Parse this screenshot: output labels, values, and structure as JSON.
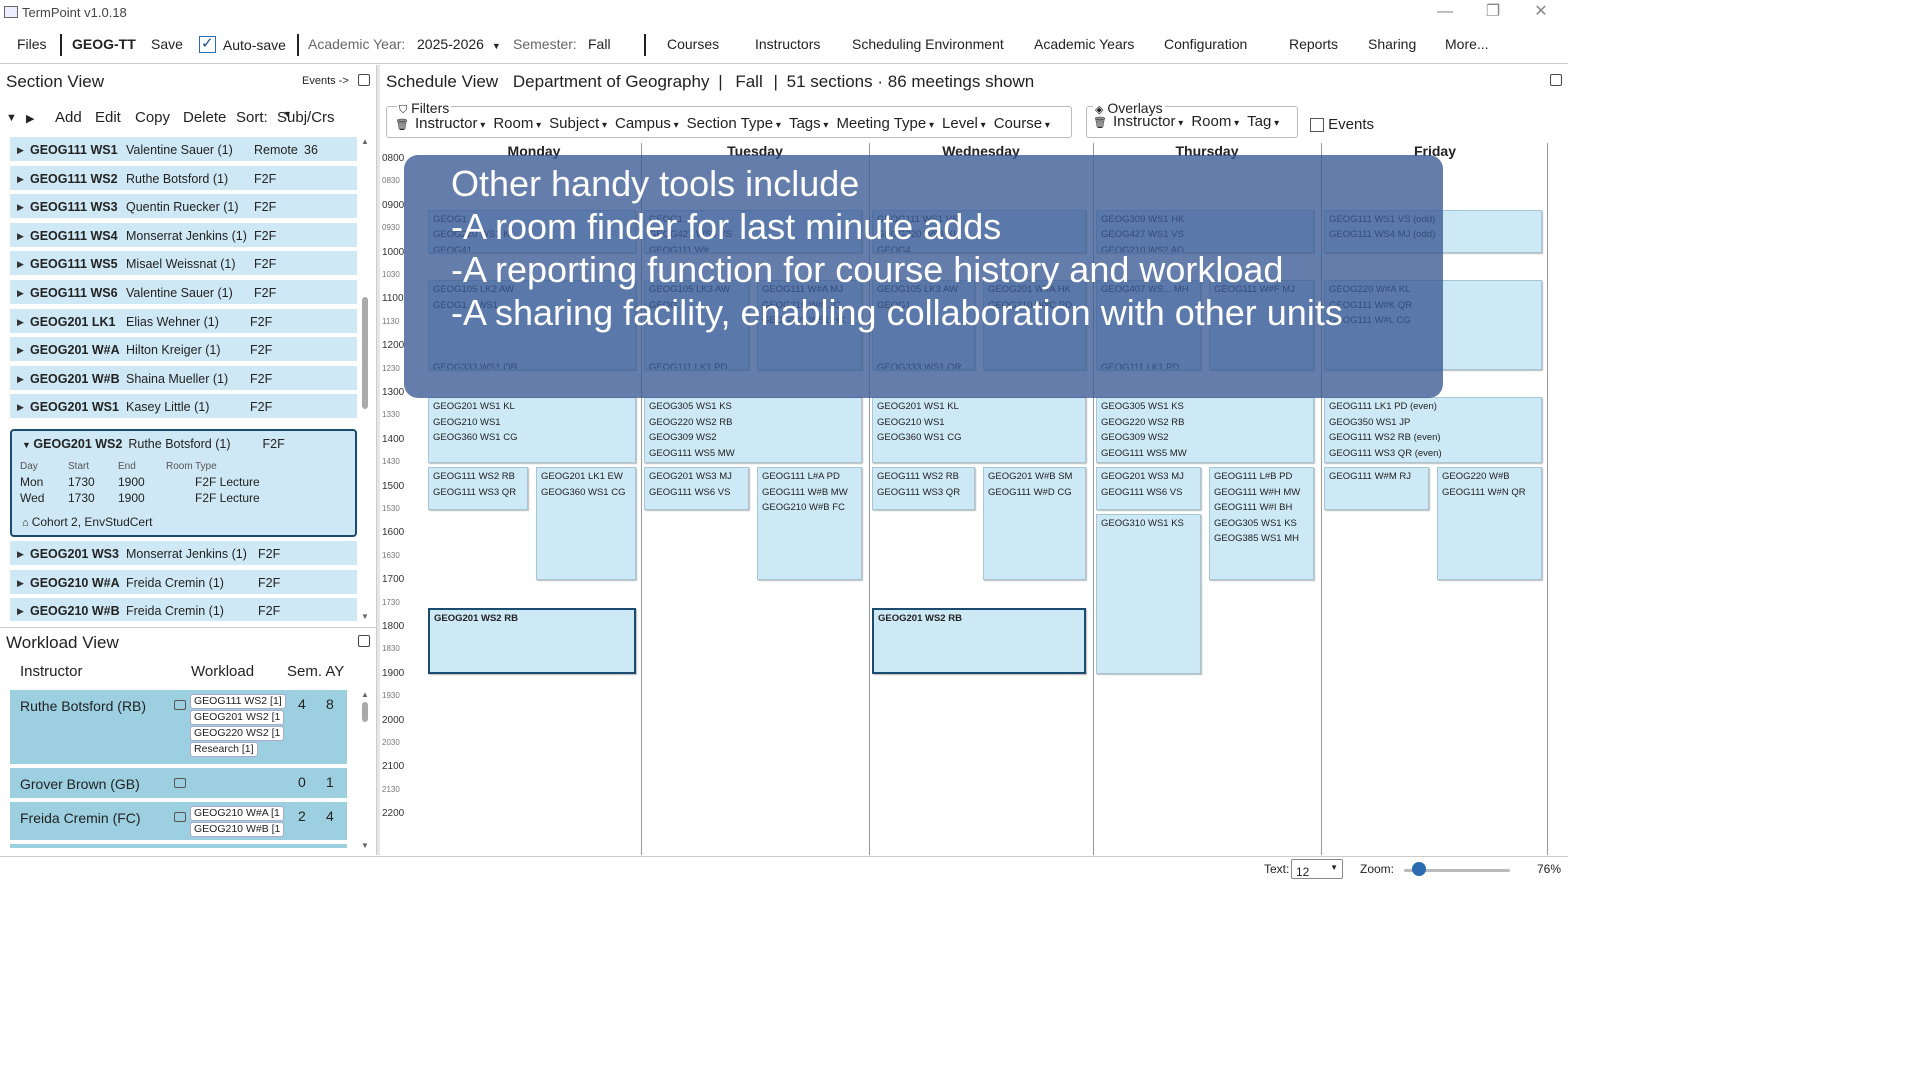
{
  "window": {
    "title": "TermPoint v1.0.18",
    "minimize": "—",
    "restore": "❐",
    "close": "✕"
  },
  "menubar": {
    "files": "Files",
    "file_name": "GEOG-TT",
    "save": "Save",
    "autosave": "Auto-save",
    "academic_year_label": "Academic Year:",
    "academic_year_value": "2025-2026",
    "semester_label": "Semester:",
    "semester_value": "Fall",
    "menus": [
      "Courses",
      "Instructors",
      "Scheduling Environment",
      "Academic Years",
      "Configuration",
      "Reports",
      "Sharing",
      "More..."
    ]
  },
  "section_view": {
    "title": "Section View",
    "events_link": "Events ->",
    "toolbar": {
      "expand": "▼",
      "collapse": "▶",
      "add": "Add",
      "edit": "Edit",
      "copy": "Copy",
      "delete": "Delete",
      "sort_label": "Sort:",
      "sort_value": "Subj/Crs"
    },
    "rows": [
      {
        "code": "GEOG111 WS1",
        "instr": "Valentine Sauer (1)",
        "type": "Remote",
        "extra": "36"
      },
      {
        "code": "GEOG111 WS2",
        "instr": "Ruthe Botsford (1)",
        "type": "F2F",
        "extra": ""
      },
      {
        "code": "GEOG111 WS3",
        "instr": "Quentin Ruecker (1)",
        "type": "F2F",
        "extra": ""
      },
      {
        "code": "GEOG111 WS4",
        "instr": "Monserrat Jenkins (1)",
        "type": "F2F",
        "extra": ""
      },
      {
        "code": "GEOG111 WS5",
        "instr": "Misael Weissnat (1)",
        "type": "F2F",
        "extra": ""
      },
      {
        "code": "GEOG111 WS6",
        "instr": "Valentine Sauer (1)",
        "type": "F2F",
        "extra": ""
      },
      {
        "code": "GEOG201 LK1",
        "instr": "Elias Wehner (1)",
        "type": "F2F",
        "extra": ""
      },
      {
        "code": "GEOG201 W#A",
        "instr": "Hilton Kreiger (1)",
        "type": "F2F",
        "extra": ""
      },
      {
        "code": "GEOG201 W#B",
        "instr": "Shaina Mueller (1)",
        "type": "F2F",
        "extra": ""
      },
      {
        "code": "GEOG201 WS1",
        "instr": "Kasey Little (1)",
        "type": "F2F",
        "extra": ""
      }
    ],
    "expanded": {
      "code": "GEOG201 WS2",
      "instr": "Ruthe Botsford (1)",
      "type": "F2F",
      "headers": {
        "day": "Day",
        "start": "Start",
        "end": "End",
        "room": "Room",
        "type": "Type"
      },
      "meetings": [
        {
          "day": "Mon",
          "start": "1730",
          "end": "1900",
          "room": "",
          "type": "F2F Lecture"
        },
        {
          "day": "Wed",
          "start": "1730",
          "end": "1900",
          "room": "",
          "type": "F2F Lecture"
        }
      ],
      "tags": "Cohort 2, EnvStudCert"
    },
    "rows_after": [
      {
        "code": "GEOG201 WS3",
        "instr": "Monserrat Jenkins (1)",
        "type": "F2F"
      },
      {
        "code": "GEOG210 W#A",
        "instr": "Freida Cremin (1)",
        "type": "F2F"
      },
      {
        "code": "GEOG210 W#B",
        "instr": "Freida Cremin (1)",
        "type": "F2F"
      }
    ]
  },
  "workload_view": {
    "title": "Workload View",
    "headers": {
      "instructor": "Instructor",
      "workload": "Workload",
      "sem_ay": "Sem. AY"
    },
    "rows": [
      {
        "name": "Ruthe Botsford (RB)",
        "chips": [
          "GEOG111 WS2 [1]",
          "GEOG201 WS2 [1",
          "GEOG220 WS2 [1",
          "Research [1]"
        ],
        "sem": "4",
        "ay": "8"
      },
      {
        "name": "Grover Brown (GB)",
        "chips": [],
        "sem": "0",
        "ay": "1"
      },
      {
        "name": "Freida Cremin (FC)",
        "chips": [
          "GEOG210 W#A [1",
          "GEOG210 W#B [1"
        ],
        "sem": "2",
        "ay": "4"
      }
    ]
  },
  "schedule_view": {
    "title": "Schedule View",
    "department": "Department of Geography",
    "semester": "Fall",
    "summary": "51 sections · 86 meetings shown",
    "filters_label": "Filters",
    "filters": [
      "Instructor",
      "Room",
      "Subject",
      "Campus",
      "Section Type",
      "Tags",
      "Meeting Type",
      "Level",
      "Course"
    ],
    "overlays_label": "Overlays",
    "overlays": [
      "Instructor",
      "Room",
      "Tag"
    ],
    "events_label": "Events",
    "days": [
      "Monday",
      "Tuesday",
      "Wednesday",
      "Thursday",
      "Friday"
    ],
    "times": [
      "0800",
      "0830",
      "0900",
      "0930",
      "1000",
      "1030",
      "1100",
      "1130",
      "1200",
      "1230",
      "1300",
      "1330",
      "1400",
      "1430",
      "1500",
      "1530",
      "1600",
      "1630",
      "1700",
      "1730",
      "1800",
      "1830",
      "1900",
      "1930",
      "2000",
      "2030",
      "2100",
      "2130",
      "2200"
    ],
    "blocks": [
      {
        "day": 0,
        "col": 0,
        "cols": 1,
        "start": 900,
        "end": 1000,
        "lines": [
          "GEOG1...",
          "GEOG220 WS1 KL",
          "GEOG41..."
        ]
      },
      {
        "day": 0,
        "col": 0,
        "cols": 1,
        "start": 1030,
        "end": 1230,
        "lines": [
          "GEOG105 LK2 AW",
          "GEOG1... WS1",
          "",
          "",
          "",
          "GEOG333 WS1 QR"
        ]
      },
      {
        "day": 0,
        "col": 0,
        "cols": 1,
        "start": 1300,
        "end": 1430,
        "lines": [
          "GEOG201 WS1 KL",
          "GEOG210 WS1",
          "GEOG360 WS1 CG"
        ]
      },
      {
        "day": 0,
        "col": 0,
        "cols": 2,
        "start": 1430,
        "end": 1530,
        "lines": [
          "GEOG111 WS2 RB",
          "GEOG111 WS3 QR"
        ]
      },
      {
        "day": 0,
        "col": 1,
        "cols": 2,
        "start": 1430,
        "end": 1700,
        "lines": [
          "GEOG201 LK1 EW",
          "GEOG360 WS1 CG"
        ]
      },
      {
        "day": 0,
        "col": 0,
        "cols": 1,
        "start": 1730,
        "end": 1900,
        "lines": [
          "GEOG201 WS2 RB"
        ],
        "selected": true
      },
      {
        "day": 1,
        "col": 0,
        "cols": 1,
        "start": 900,
        "end": 1000,
        "lines": [
          "GEOG1...",
          "GEOG427 WS1 VS",
          "GEOG111 W#..."
        ]
      },
      {
        "day": 1,
        "col": 0,
        "cols": 2,
        "start": 1030,
        "end": 1230,
        "lines": [
          "GEOG105 LK3 AW",
          "GEOG...",
          "",
          "",
          "",
          "GEOG111 LK1 PD",
          "GEOG320 WS1 SW"
        ]
      },
      {
        "day": 1,
        "col": 1,
        "cols": 2,
        "start": 1030,
        "end": 1230,
        "lines": [
          "GEOG111 W#A MJ",
          "GEOG210 W#... C",
          "GEOG309 WS1 HK"
        ]
      },
      {
        "day": 1,
        "col": 0,
        "cols": 1,
        "start": 1300,
        "end": 1430,
        "lines": [
          "GEOG305 WS1 KS",
          "GEOG220 WS2 RB",
          "GEOG309 WS2",
          "GEOG111 WS5 MW"
        ]
      },
      {
        "day": 1,
        "col": 0,
        "cols": 2,
        "start": 1430,
        "end": 1530,
        "lines": [
          "GEOG201 WS3 MJ",
          "GEOG111 WS6 VS"
        ]
      },
      {
        "day": 1,
        "col": 1,
        "cols": 2,
        "start": 1430,
        "end": 1700,
        "lines": [
          "GEOG111 L#A PD",
          "GEOG111 W#B MW",
          "GEOG210 W#B FC"
        ]
      },
      {
        "day": 2,
        "col": 0,
        "cols": 1,
        "start": 900,
        "end": 1000,
        "lines": [
          "GEOG111 WS1 VS",
          "GEOG220 WS1 KL",
          "GEOG4..."
        ]
      },
      {
        "day": 2,
        "col": 0,
        "cols": 2,
        "start": 1030,
        "end": 1230,
        "lines": [
          "GEOG105 LK3 AW",
          "GEOG1...",
          "",
          "",
          "",
          "GEOG333 WS1 QR"
        ]
      },
      {
        "day": 2,
        "col": 1,
        "cols": 2,
        "start": 1030,
        "end": 1230,
        "lines": [
          "GEOG201 W#A HK",
          "GEOG210 W#C PD"
        ]
      },
      {
        "day": 2,
        "col": 0,
        "cols": 1,
        "start": 1300,
        "end": 1430,
        "lines": [
          "GEOG201 WS1 KL",
          "GEOG210 WS1",
          "GEOG360 WS1 CG"
        ]
      },
      {
        "day": 2,
        "col": 0,
        "cols": 2,
        "start": 1430,
        "end": 1530,
        "lines": [
          "GEOG111 WS2 RB",
          "GEOG111 WS3 QR"
        ]
      },
      {
        "day": 2,
        "col": 1,
        "cols": 2,
        "start": 1430,
        "end": 1700,
        "lines": [
          "GEOG201 W#B SM",
          "GEOG111 W#D CG"
        ]
      },
      {
        "day": 2,
        "col": 0,
        "cols": 1,
        "start": 1730,
        "end": 1900,
        "lines": [
          "GEOG201 WS2 RB"
        ],
        "selected": true
      },
      {
        "day": 3,
        "col": 0,
        "cols": 1,
        "start": 900,
        "end": 1000,
        "lines": [
          "GEOG309 WS1 HK",
          "GEOG427 WS1 VS",
          "GEOG210 WS2 AD",
          "GEOG111 WS4 MJ"
        ]
      },
      {
        "day": 3,
        "col": 0,
        "cols": 2,
        "start": 1030,
        "end": 1230,
        "lines": [
          "GEOG407 WS... MH",
          "",
          "",
          "",
          "",
          "GEOG111 LK1 PD",
          "GEOG320 WS1 SW"
        ]
      },
      {
        "day": 3,
        "col": 1,
        "cols": 2,
        "start": 1030,
        "end": 1230,
        "lines": [
          "GEOG111 W#F MJ"
        ]
      },
      {
        "day": 3,
        "col": 0,
        "cols": 1,
        "start": 1300,
        "end": 1430,
        "lines": [
          "GEOG305 WS1 KS",
          "GEOG220 WS2 RB",
          "GEOG309 WS2",
          "GEOG111 WS5 MW"
        ]
      },
      {
        "day": 3,
        "col": 0,
        "cols": 2,
        "start": 1430,
        "end": 1530,
        "lines": [
          "GEOG201 WS3 MJ",
          "GEOG111 WS6 VS"
        ]
      },
      {
        "day": 3,
        "col": 0,
        "cols": 2,
        "start": 1530,
        "end": 1900,
        "lines": [
          "GEOG310 WS1 KS"
        ]
      },
      {
        "day": 3,
        "col": 1,
        "cols": 2,
        "start": 1430,
        "end": 1700,
        "lines": [
          "GEOG111 L#B PD",
          "GEOG111 W#H MW",
          "GEOG111 W#I BH",
          "GEOG305 WS1 KS",
          "GEOG385 WS1 MH"
        ]
      },
      {
        "day": 4,
        "col": 0,
        "cols": 1,
        "start": 900,
        "end": 1000,
        "lines": [
          "GEOG111 WS1 VS (odd)",
          "GEOG111 WS4 MJ (odd)"
        ]
      },
      {
        "day": 4,
        "col": 0,
        "cols": 1,
        "start": 1030,
        "end": 1230,
        "lines": [
          "GEOG220 W#A KL",
          "GEOG111 W#K QR",
          "GEOG111 W#L CG"
        ]
      },
      {
        "day": 4,
        "col": 0,
        "cols": 1,
        "start": 1300,
        "end": 1430,
        "lines": [
          "GEOG111 LK1 PD (even)",
          "GEOG350 WS1 JP",
          "GEOG111 WS2 RB (even)",
          "GEOG111 WS3 QR (even)",
          "GEOG111 WS5 MW (odd)",
          "GEOG111 WS6 VS (odd)"
        ]
      },
      {
        "day": 4,
        "col": 0,
        "cols": 2,
        "start": 1430,
        "end": 1530,
        "lines": [
          "GEOG111 W#M RJ"
        ]
      },
      {
        "day": 4,
        "col": 1,
        "cols": 2,
        "start": 1430,
        "end": 1700,
        "lines": [
          "GEOG220 W#B",
          "GEOG111 W#N QR"
        ]
      }
    ]
  },
  "overlay_message": {
    "lines": [
      "Other handy tools include",
      "-A room finder for last minute adds",
      "-A reporting function for course history and workload",
      "-A sharing facility, enabling collaboration with other units"
    ]
  },
  "statusbar": {
    "text_label": "Text:",
    "text_value": "12",
    "zoom_label": "Zoom:",
    "zoom_percent": "76%",
    "zoom_fraction": 0.12
  }
}
